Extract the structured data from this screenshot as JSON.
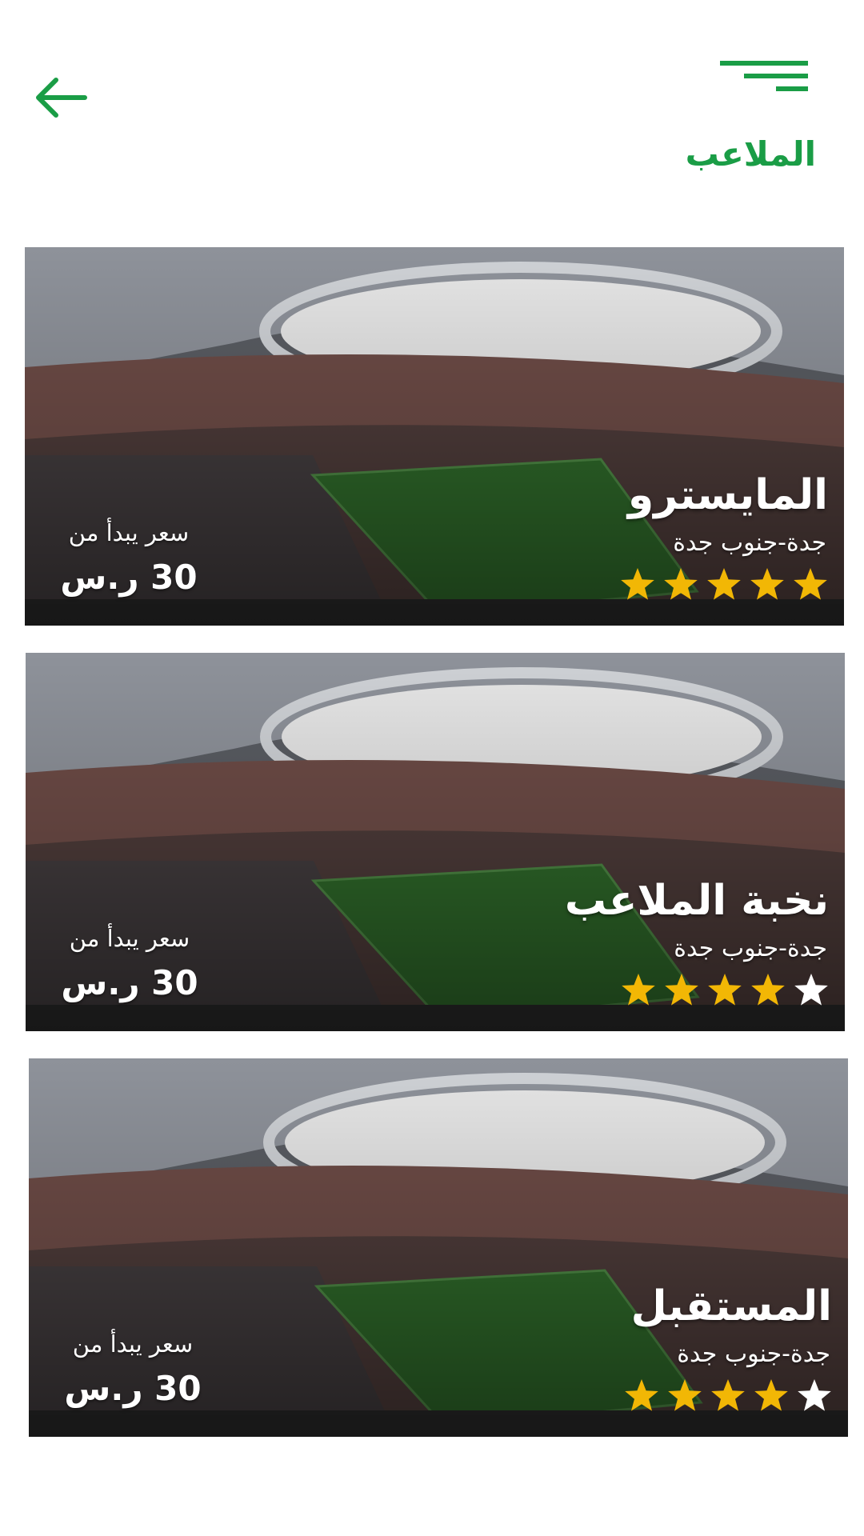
{
  "header": {
    "title": "الملاعب",
    "back_icon": "arrow-left-icon",
    "menu_icon": "menu-icon"
  },
  "colors": {
    "accent": "#1a9d46",
    "star_filled": "#f2b705",
    "star_empty": "#ffffff"
  },
  "venues": [
    {
      "name": "المايسترو",
      "location": "جدة-جنوب جدة",
      "rating": 5,
      "price_label": "سعر يبدأ من",
      "price": "30 ر.س"
    },
    {
      "name": "نخبة الملاعب",
      "location": "جدة-جنوب جدة",
      "rating": 4,
      "price_label": "سعر يبدأ من",
      "price": "30 ر.س"
    },
    {
      "name": "المستقبل",
      "location": "جدة-جنوب جدة",
      "rating": 4,
      "price_label": "سعر يبدأ من",
      "price": "30 ر.س"
    }
  ]
}
